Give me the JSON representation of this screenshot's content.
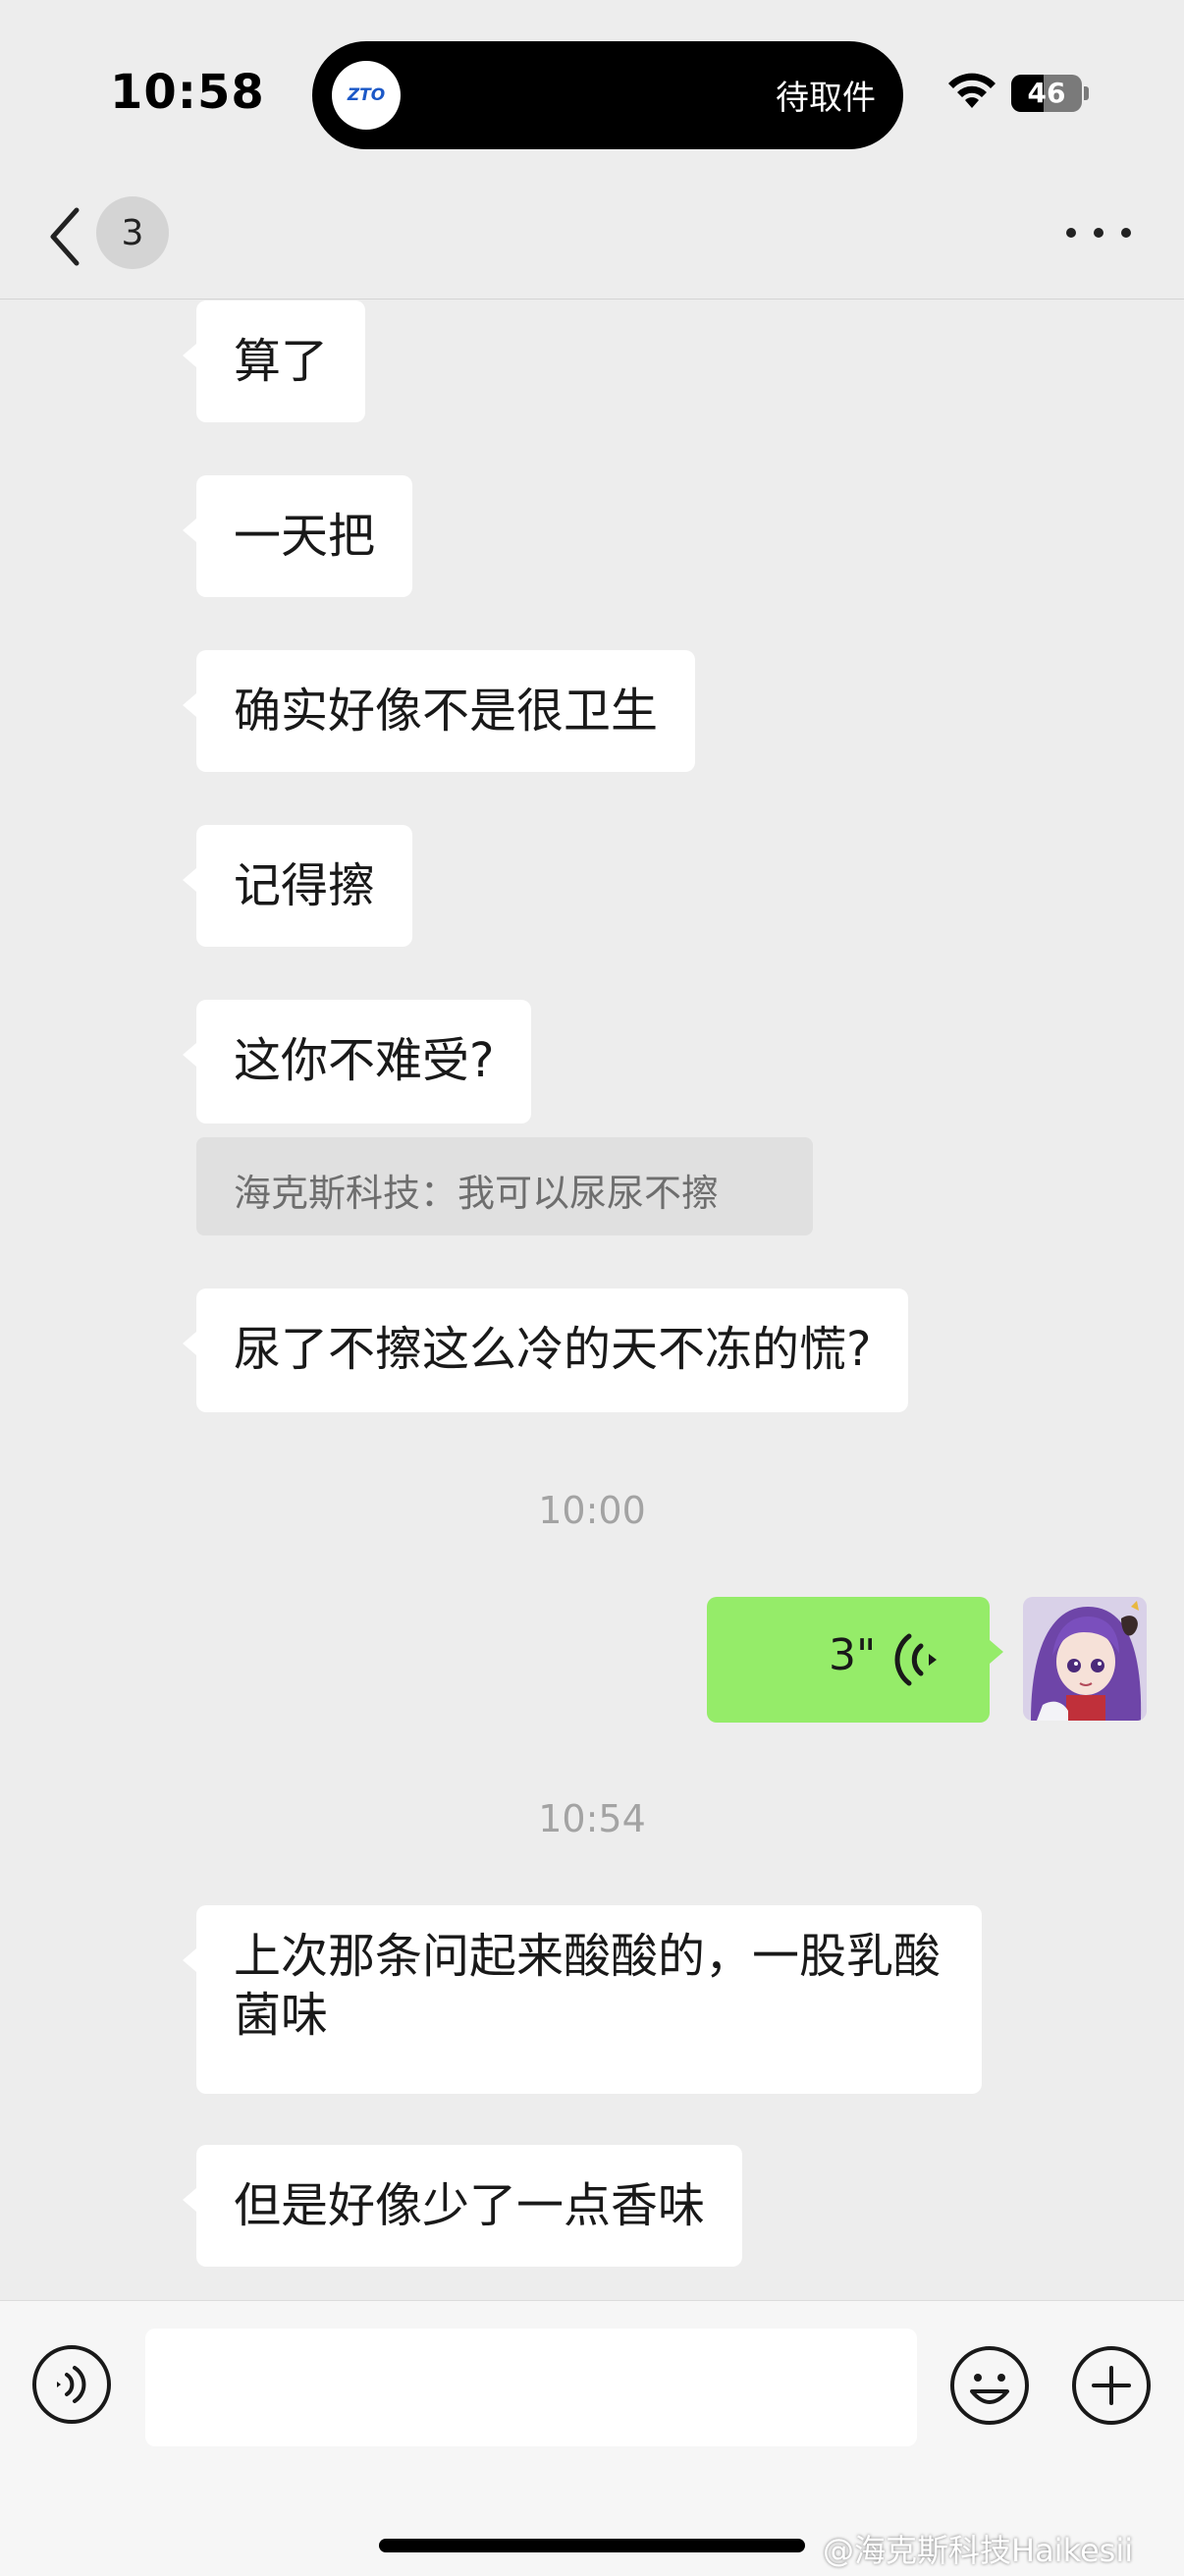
{
  "status_bar": {
    "time": "10:58",
    "island_logo_text": "ZTO",
    "island_label": "待取件",
    "battery_level": "46",
    "battery_fraction": 0.46
  },
  "nav": {
    "unread_count": "3"
  },
  "messages": [
    {
      "text": "算了"
    },
    {
      "text": "一天把"
    },
    {
      "text": "确实好像不是很卫生"
    },
    {
      "text": "记得擦"
    },
    {
      "text": "这你不难受?"
    },
    {
      "text": "尿了不擦这么冷的天不冻的慌?"
    },
    {
      "text": "上次那条问起来酸酸的，一股乳酸菌味"
    },
    {
      "text": "但是好像少了一点香味"
    }
  ],
  "quote": {
    "text": "海克斯科技：我可以尿尿不擦"
  },
  "timestamps": [
    "10:00",
    "10:54"
  ],
  "voice_message": {
    "duration": "3\""
  },
  "input": {
    "placeholder": ""
  },
  "watermark": "@海克斯科技Haikesii",
  "colors": {
    "background": "#ededed",
    "incoming_bubble": "#ffffff",
    "outgoing_bubble": "#95ec69",
    "quote_bg": "#e0e0e0"
  }
}
